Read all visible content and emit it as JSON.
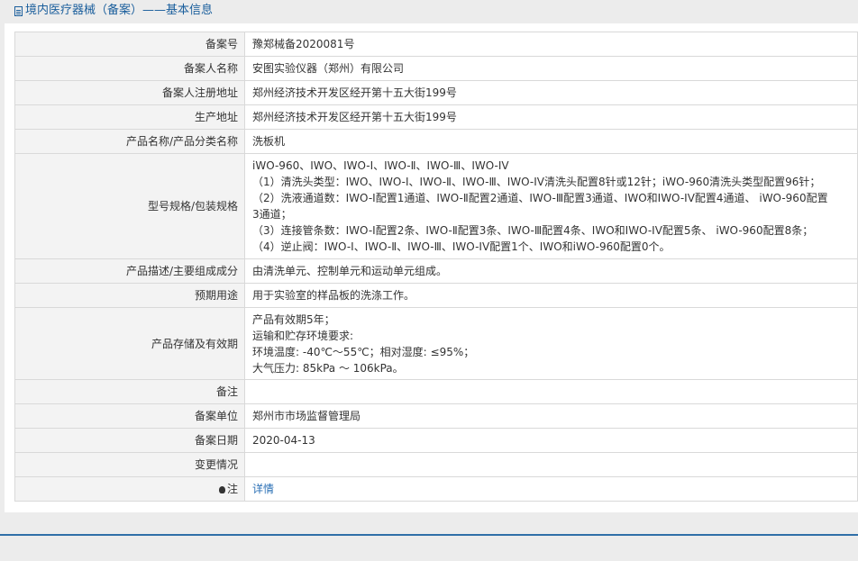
{
  "header": {
    "title": "境内医疗器械（备案）——基本信息"
  },
  "rows": [
    {
      "label": "备案号",
      "value": [
        "豫郑械备2020081号"
      ]
    },
    {
      "label": "备案人名称",
      "value": [
        "安图实验仪器（郑州）有限公司"
      ]
    },
    {
      "label": "备案人注册地址",
      "value": [
        "郑州经济技术开发区经开第十五大街199号"
      ]
    },
    {
      "label": "生产地址",
      "value": [
        "郑州经济技术开发区经开第十五大街199号"
      ]
    },
    {
      "label": "产品名称/产品分类名称",
      "value": [
        "洗板机"
      ]
    },
    {
      "label": "型号规格/包装规格",
      "value": [
        "iWO-960、IWO、IWO-Ⅰ、IWO-Ⅱ、IWO-Ⅲ、IWO-IV",
        "（1）清洗头类型：IWO、IWO-Ⅰ、IWO-Ⅱ、IWO-Ⅲ、IWO-IV清洗头配置8针或12针；iWO-960清洗头类型配置96针；",
        "（2）洗液通道数：IWO-Ⅰ配置1通道、IWO-Ⅱ配置2通道、IWO-Ⅲ配置3通道、IWO和IWO-IV配置4通道、 iWO-960配置",
        "3通道；",
        "（3）连接管条数：IWO-Ⅰ配置2条、IWO-Ⅱ配置3条、IWO-Ⅲ配置4条、IWO和IWO-IV配置5条、 iWO-960配置8条；",
        "（4）逆止阀：IWO-Ⅰ、IWO-Ⅱ、IWO-Ⅲ、IWO-IV配置1个、IWO和iWO-960配置0个。"
      ]
    },
    {
      "label": "产品描述/主要组成成分",
      "value": [
        "由清洗单元、控制单元和运动单元组成。"
      ]
    },
    {
      "label": "预期用途",
      "value": [
        "用于实验室的样品板的洗涤工作。"
      ]
    },
    {
      "label": "产品存储及有效期",
      "value": [
        "产品有效期5年；",
        "运输和贮存环境要求:",
        "环境温度: -40℃～55℃；相对湿度: ≤95%；",
        "大气压力: 85kPa ～ 106kPa。"
      ]
    },
    {
      "label": "备注",
      "value": [
        ""
      ]
    },
    {
      "label": "备案单位",
      "value": [
        "郑州市市场监督管理局"
      ]
    },
    {
      "label": "备案日期",
      "value": [
        "2020-04-13"
      ]
    },
    {
      "label": "变更情况",
      "value": [
        ""
      ]
    }
  ],
  "note": {
    "label": "注",
    "link_text": "详情",
    "icon": "bulb-icon"
  }
}
